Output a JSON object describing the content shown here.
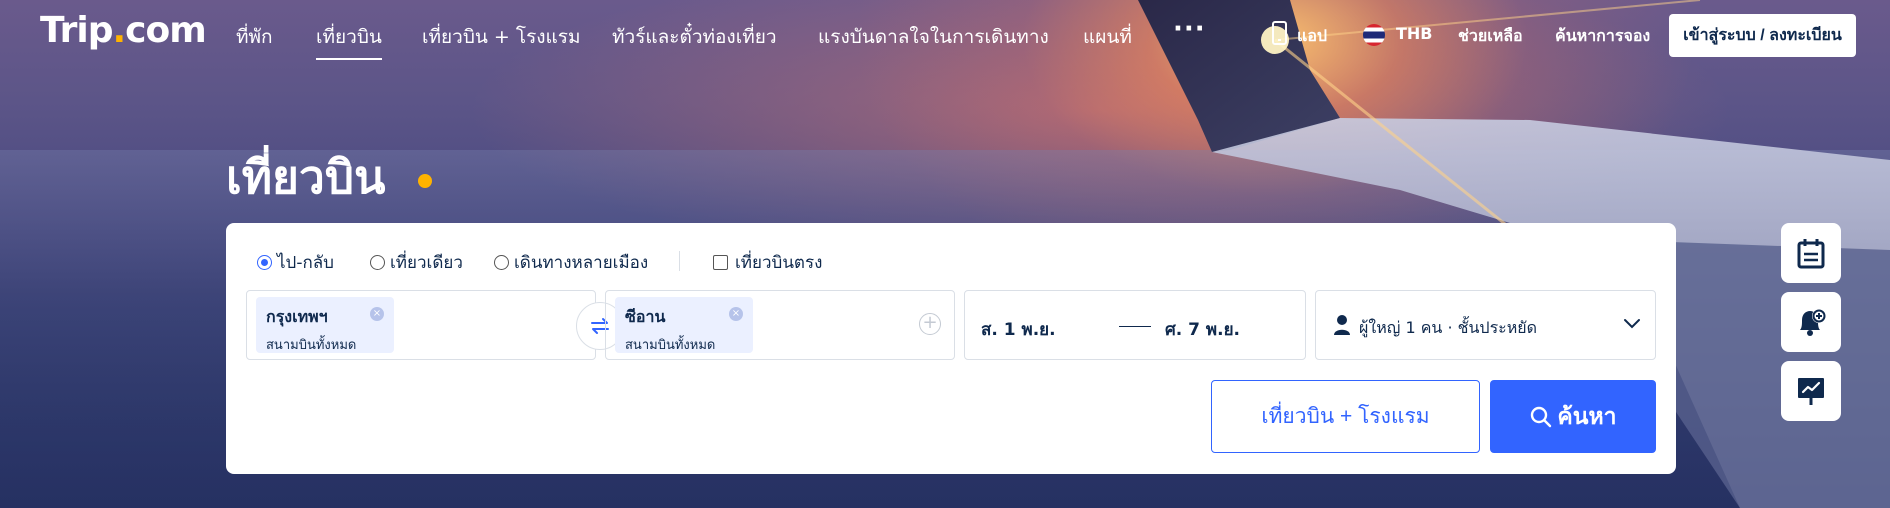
{
  "brand": {
    "logo_left": "Trip",
    "logo_dot": ".",
    "logo_right": "com"
  },
  "nav": {
    "items": [
      {
        "label": "ที่พัก"
      },
      {
        "label": "เที่ยวบิน",
        "active": true
      },
      {
        "label": "เที่ยวบิน + โรงแรม"
      },
      {
        "label": "ทัวร์และตั๋วท่องเที่ยว"
      },
      {
        "label": "แรงบันดาลใจในการเดินทาง"
      },
      {
        "label": "แผนที่"
      }
    ],
    "more": "···",
    "app_label": "แอป",
    "currency": "THB",
    "help": "ช่วยเหลือ",
    "find_booking": "ค้นหาการจอง",
    "login": "เข้าสู่ระบบ / ลงทะเบียน"
  },
  "page": {
    "title": "เที่ยวบิน"
  },
  "search": {
    "trip_types": [
      {
        "label": "ไป-กลับ",
        "selected": true
      },
      {
        "label": "เที่ยวเดียว",
        "selected": false
      },
      {
        "label": "เดินทางหลายเมือง",
        "selected": false
      }
    ],
    "direct_only": {
      "label": "เที่ยวบินตรง",
      "checked": false
    },
    "origin": {
      "city": "กรุงเทพฯ",
      "airport": "สนามบินทั้งหมด"
    },
    "destination": {
      "city": "ซีอาน",
      "airport": "สนามบินทั้งหมด"
    },
    "depart_date": "ส. 1 พ.ย.",
    "return_date": "ศ. 7 พ.ย.",
    "passengers": "ผู้ใหญ่ 1 คน · ชั้นประหยัด",
    "combo_label": "เที่ยวบิน + โรงแรม",
    "search_label": "ค้นหา"
  },
  "colors": {
    "primary": "#3264ff",
    "accent": "#ffb300",
    "text": "#0f294d"
  },
  "icons": [
    "swap-icon",
    "calendar-icon",
    "price-alert-icon",
    "price-trend-icon",
    "user-icon",
    "chevron-down-icon",
    "search-icon",
    "phone-icon"
  ]
}
